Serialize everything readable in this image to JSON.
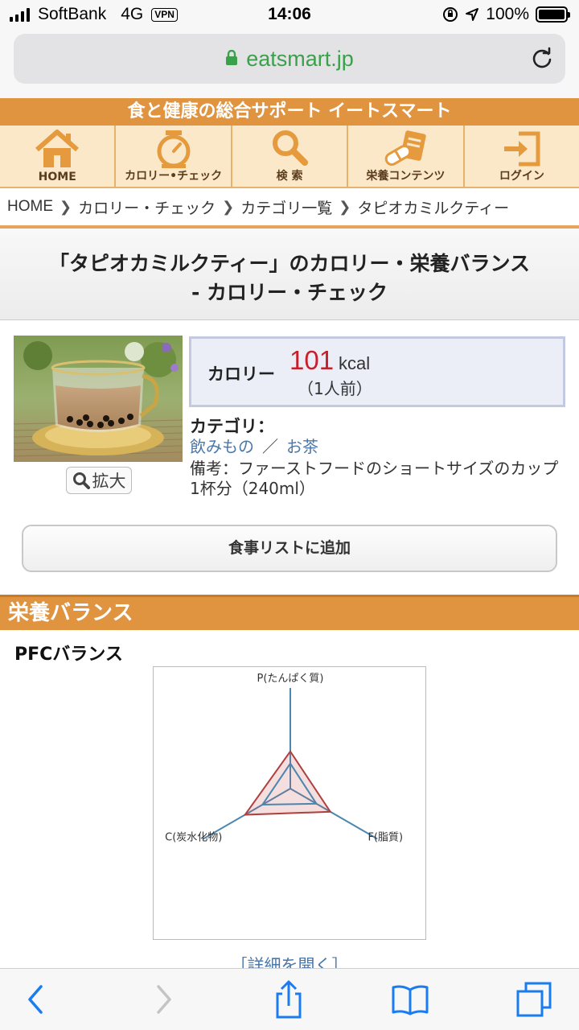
{
  "status_bar": {
    "carrier": "SoftBank",
    "network": "4G",
    "vpn": "VPN",
    "time": "14:06",
    "battery": "100%"
  },
  "browser": {
    "url": "eatsmart.jp"
  },
  "site": {
    "title": "食と健康の総合サポート イートスマート",
    "nav": [
      {
        "label": "HOME",
        "icon": "home-icon"
      },
      {
        "label": "カロリー•チェック",
        "icon": "scale-icon"
      },
      {
        "label": "検 索",
        "icon": "search-icon"
      },
      {
        "label": "栄養コンテンツ",
        "icon": "pill-book-icon"
      },
      {
        "label": "ログイン",
        "icon": "login-icon"
      }
    ]
  },
  "breadcrumb": [
    "HOME",
    "カロリー・チェック",
    "カテゴリ一覧",
    "タピオカミルクティー"
  ],
  "page": {
    "heading_line1": "「タピオカミルクティー」のカロリー・栄養バランス",
    "heading_line2": "- カロリー・チェック"
  },
  "food": {
    "zoom_label": "拡大",
    "calorie_label": "カロリー",
    "calorie_value": "101",
    "calorie_unit": "kcal",
    "serving": "（1人前）",
    "category_label": "カテゴリ：",
    "category_1": "飲みもの",
    "category_sep": "／",
    "category_2": "お茶",
    "note": "備考：ファーストフードのショートサイズのカップ1杯分（240ml）",
    "add_button": "食事リストに追加"
  },
  "nutrition": {
    "section_title": "栄養バランス",
    "pfc_title": "PFCバランス",
    "details_link": "［詳細を開く］"
  },
  "chart_data": {
    "type": "radar",
    "axes": [
      "P(たんぱく質)",
      "F(脂質)",
      "C(炭水化物)"
    ],
    "series": [
      {
        "values": [
          0.37,
          0.46,
          0.52
        ],
        "color": "#b04040"
      },
      {
        "values": [
          0.25,
          0.3,
          0.32
        ],
        "color": "#4a86b0"
      }
    ]
  },
  "colors": {
    "accent_orange": "#e09440",
    "nav_bg": "#fbe8c9",
    "calorie_red": "#c8202a",
    "link_blue": "#4b78a8",
    "url_green": "#3aa14a"
  }
}
